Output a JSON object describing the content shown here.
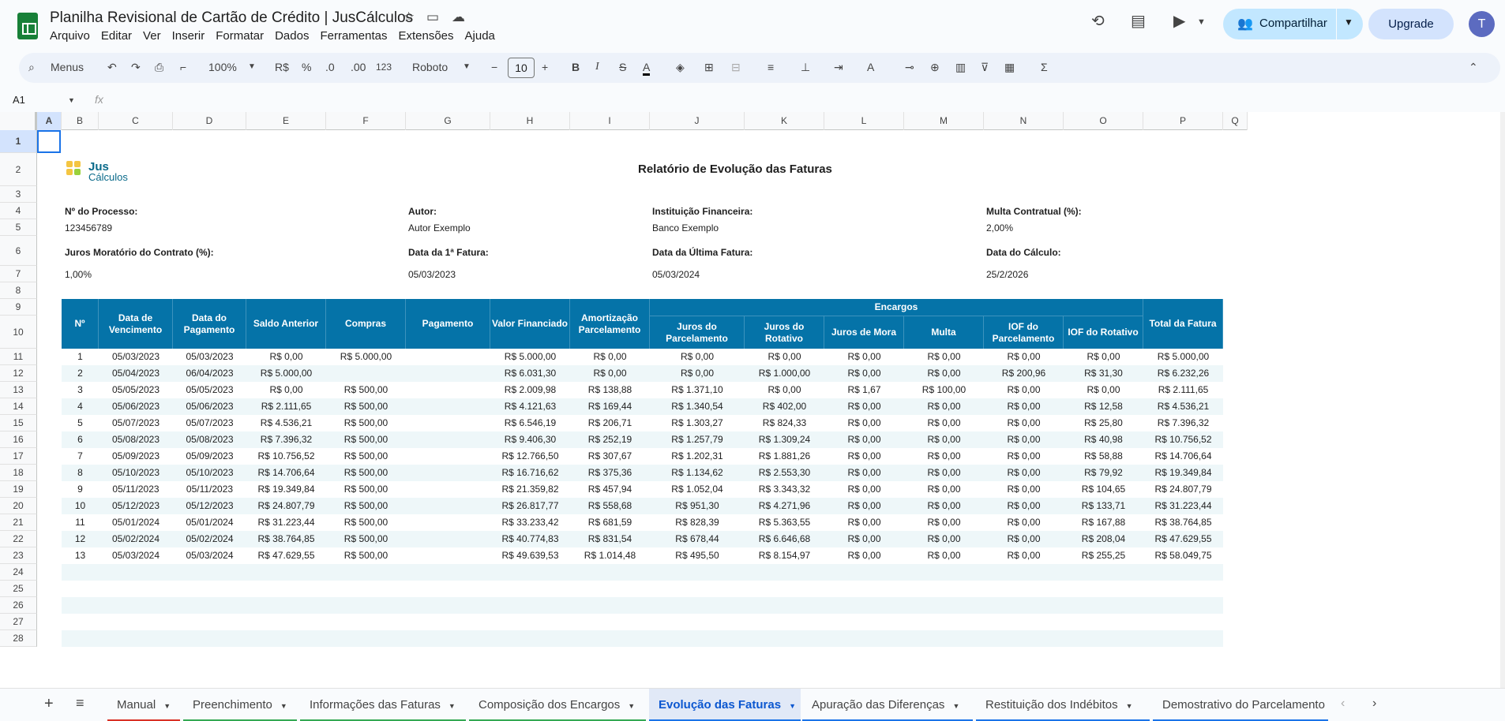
{
  "app": {
    "doc_title": "Planilha Revisional de Cartão de Crédito | JusCálculos",
    "menu": [
      "Arquivo",
      "Editar",
      "Ver",
      "Inserir",
      "Formatar",
      "Dados",
      "Ferramentas",
      "Extensões",
      "Ajuda"
    ],
    "share_label": "Compartilhar",
    "upgrade_label": "Upgrade",
    "avatar_letter": "T"
  },
  "toolbar": {
    "menus_label": "Menus",
    "zoom": "100%",
    "currency": "R$",
    "percent": "%",
    "dec_less": ".0",
    "dec_more": ".00",
    "number_format": "123",
    "font": "Roboto",
    "font_size": "10"
  },
  "formula_bar": {
    "cell_ref": "A1",
    "fx": "fx"
  },
  "columns": [
    "A",
    "B",
    "C",
    "D",
    "E",
    "F",
    "G",
    "H",
    "I",
    "J",
    "K",
    "L",
    "M",
    "N",
    "O",
    "P",
    "Q"
  ],
  "rows": [
    "1",
    "2",
    "3",
    "4",
    "5",
    "6",
    "7",
    "8",
    "9",
    "10",
    "11",
    "12",
    "13",
    "14",
    "15",
    "16",
    "17",
    "18",
    "19",
    "20",
    "21",
    "22",
    "23",
    "24",
    "25",
    "26",
    "27",
    "28"
  ],
  "logo": {
    "line1": "Jus",
    "line2": "Cálculos"
  },
  "report": {
    "title": "Relatório de Evolução das Faturas",
    "fields": [
      {
        "label": "Nº do Processo:",
        "value": "123456789"
      },
      {
        "label": "Autor:",
        "value": "Autor Exemplo"
      },
      {
        "label": "Instituição Financeira:",
        "value": "Banco Exemplo"
      },
      {
        "label": "Multa Contratual (%):",
        "value": "2,00%"
      },
      {
        "label": "Juros Moratório do Contrato (%):",
        "value": "1,00%"
      },
      {
        "label": "Data da 1ª Fatura:",
        "value": "05/03/2023"
      },
      {
        "label": "Data da Última Fatura:",
        "value": "05/03/2024"
      },
      {
        "label": "Data do Cálculo:",
        "value": "25/2/2026"
      }
    ]
  },
  "table": {
    "headers": [
      "Nº",
      "Data de Vencimento",
      "Data do Pagamento",
      "Saldo Anterior",
      "Compras",
      "Pagamento",
      "Valor Financiado",
      "Amortização Parcelamento",
      "Juros do Parcelamento",
      "Juros do Rotativo",
      "Juros de Mora",
      "Multa",
      "IOF do Parcelamento",
      "IOF do Rotativo",
      "Total da Fatura"
    ],
    "group_header": "Encargos",
    "rows": [
      [
        "1",
        "05/03/2023",
        "05/03/2023",
        "R$ 0,00",
        "R$ 5.000,00",
        "",
        "R$ 5.000,00",
        "R$ 0,00",
        "R$ 0,00",
        "R$ 0,00",
        "R$ 0,00",
        "R$ 0,00",
        "R$ 0,00",
        "R$ 0,00",
        "R$ 5.000,00"
      ],
      [
        "2",
        "05/04/2023",
        "06/04/2023",
        "R$ 5.000,00",
        "",
        "",
        "R$ 6.031,30",
        "R$ 0,00",
        "R$ 0,00",
        "R$ 1.000,00",
        "R$ 0,00",
        "R$ 0,00",
        "R$ 200,96",
        "R$ 31,30",
        "R$ 6.232,26"
      ],
      [
        "3",
        "05/05/2023",
        "05/05/2023",
        "R$ 0,00",
        "R$ 500,00",
        "",
        "R$ 2.009,98",
        "R$ 138,88",
        "R$ 1.371,10",
        "R$ 0,00",
        "R$ 1,67",
        "R$ 100,00",
        "R$ 0,00",
        "R$ 0,00",
        "R$ 2.111,65"
      ],
      [
        "4",
        "05/06/2023",
        "05/06/2023",
        "R$ 2.111,65",
        "R$ 500,00",
        "",
        "R$ 4.121,63",
        "R$ 169,44",
        "R$ 1.340,54",
        "R$ 402,00",
        "R$ 0,00",
        "R$ 0,00",
        "R$ 0,00",
        "R$ 12,58",
        "R$ 4.536,21"
      ],
      [
        "5",
        "05/07/2023",
        "05/07/2023",
        "R$ 4.536,21",
        "R$ 500,00",
        "",
        "R$ 6.546,19",
        "R$ 206,71",
        "R$ 1.303,27",
        "R$ 824,33",
        "R$ 0,00",
        "R$ 0,00",
        "R$ 0,00",
        "R$ 25,80",
        "R$ 7.396,32"
      ],
      [
        "6",
        "05/08/2023",
        "05/08/2023",
        "R$ 7.396,32",
        "R$ 500,00",
        "",
        "R$ 9.406,30",
        "R$ 252,19",
        "R$ 1.257,79",
        "R$ 1.309,24",
        "R$ 0,00",
        "R$ 0,00",
        "R$ 0,00",
        "R$ 40,98",
        "R$ 10.756,52"
      ],
      [
        "7",
        "05/09/2023",
        "05/09/2023",
        "R$ 10.756,52",
        "R$ 500,00",
        "",
        "R$ 12.766,50",
        "R$ 307,67",
        "R$ 1.202,31",
        "R$ 1.881,26",
        "R$ 0,00",
        "R$ 0,00",
        "R$ 0,00",
        "R$ 58,88",
        "R$ 14.706,64"
      ],
      [
        "8",
        "05/10/2023",
        "05/10/2023",
        "R$ 14.706,64",
        "R$ 500,00",
        "",
        "R$ 16.716,62",
        "R$ 375,36",
        "R$ 1.134,62",
        "R$ 2.553,30",
        "R$ 0,00",
        "R$ 0,00",
        "R$ 0,00",
        "R$ 79,92",
        "R$ 19.349,84"
      ],
      [
        "9",
        "05/11/2023",
        "05/11/2023",
        "R$ 19.349,84",
        "R$ 500,00",
        "",
        "R$ 21.359,82",
        "R$ 457,94",
        "R$ 1.052,04",
        "R$ 3.343,32",
        "R$ 0,00",
        "R$ 0,00",
        "R$ 0,00",
        "R$ 104,65",
        "R$ 24.807,79"
      ],
      [
        "10",
        "05/12/2023",
        "05/12/2023",
        "R$ 24.807,79",
        "R$ 500,00",
        "",
        "R$ 26.817,77",
        "R$ 558,68",
        "R$ 951,30",
        "R$ 4.271,96",
        "R$ 0,00",
        "R$ 0,00",
        "R$ 0,00",
        "R$ 133,71",
        "R$ 31.223,44"
      ],
      [
        "11",
        "05/01/2024",
        "05/01/2024",
        "R$ 31.223,44",
        "R$ 500,00",
        "",
        "R$ 33.233,42",
        "R$ 681,59",
        "R$ 828,39",
        "R$ 5.363,55",
        "R$ 0,00",
        "R$ 0,00",
        "R$ 0,00",
        "R$ 167,88",
        "R$ 38.764,85"
      ],
      [
        "12",
        "05/02/2024",
        "05/02/2024",
        "R$ 38.764,85",
        "R$ 500,00",
        "",
        "R$ 40.774,83",
        "R$ 831,54",
        "R$ 678,44",
        "R$ 6.646,68",
        "R$ 0,00",
        "R$ 0,00",
        "R$ 0,00",
        "R$ 208,04",
        "R$ 47.629,55"
      ],
      [
        "13",
        "05/03/2024",
        "05/03/2024",
        "R$ 47.629,55",
        "R$ 500,00",
        "",
        "R$ 49.639,53",
        "R$ 1.014,48",
        "R$ 495,50",
        "R$ 8.154,97",
        "R$ 0,00",
        "R$ 0,00",
        "R$ 0,00",
        "R$ 255,25",
        "R$ 58.049,75"
      ]
    ]
  },
  "sheet_tabs": [
    "Manual",
    "Preenchimento",
    "Informações das Faturas",
    "Composição dos Encargos",
    "Evolução das Faturas",
    "Apuração das Diferenças",
    "Restituição dos Indébitos",
    "Demostrativo do Parcelamento"
  ],
  "active_tab": "Evolução das Faturas",
  "colors": {
    "header_blue": "#0573a8",
    "stripe": "#eef7f9",
    "share_bg": "#c2e7ff",
    "active_tab_text": "#0b57d0"
  }
}
